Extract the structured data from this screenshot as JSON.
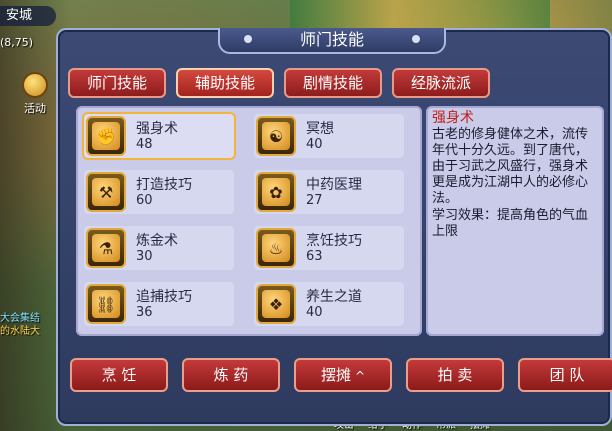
{
  "hud": {
    "city": "安城",
    "coords": "(8,75)",
    "activity_label": "活动",
    "chat_line1": "大会集结",
    "chat_line2": "的水陆大",
    "hotbar": [
      "动作",
      "帮派",
      "给予",
      "攻击",
      "摆摊"
    ]
  },
  "dialog": {
    "title": "师门技能",
    "tabs": [
      "师门技能",
      "辅助技能",
      "剧情技能",
      "经脉流派"
    ],
    "active_tab": "辅助技能",
    "skills": [
      {
        "name": "强身术",
        "level": "48",
        "icon": "strength-icon",
        "selected": true
      },
      {
        "name": "冥想",
        "level": "40",
        "icon": "meditation-icon"
      },
      {
        "name": "打造技巧",
        "level": "60",
        "icon": "forging-icon"
      },
      {
        "name": "中药医理",
        "level": "27",
        "icon": "herb-icon"
      },
      {
        "name": "炼金术",
        "level": "30",
        "icon": "alchemy-icon"
      },
      {
        "name": "烹饪技巧",
        "level": "63",
        "icon": "cooking-icon"
      },
      {
        "name": "追捕技巧",
        "level": "36",
        "icon": "hunting-icon"
      },
      {
        "name": "养生之道",
        "level": "40",
        "icon": "health-icon"
      }
    ],
    "description": {
      "title": "强身术",
      "body": "古老的修身健体之术，流传年代十分久远。到了唐代，由于习武之风盛行，强身术更是成为江湖中人的必修心法。",
      "effect": "学习效果：提高角色的气血上限"
    },
    "buttons": [
      "烹 饪",
      "炼 药",
      "摆摊",
      "拍 卖",
      "团 队"
    ],
    "stall_caret": "^"
  }
}
